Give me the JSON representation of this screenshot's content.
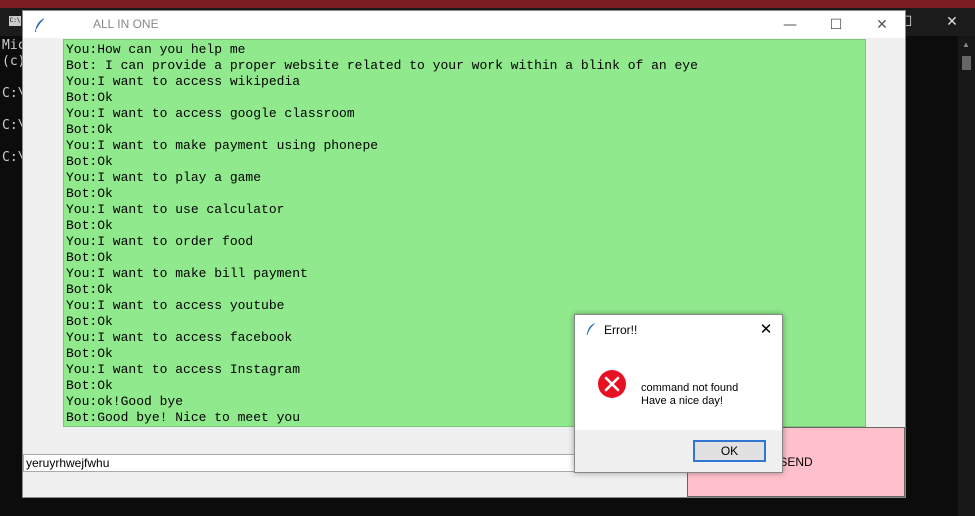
{
  "console": {
    "icon_text": "C:\\",
    "lines": [
      "Mic",
      "(c)",
      "",
      "C:\\",
      "",
      "C:\\",
      "",
      "C:\\"
    ],
    "controls": [
      "—",
      "☐",
      "✕"
    ]
  },
  "main_window": {
    "title": "ALL IN ONE",
    "controls": [
      "—",
      "☐",
      "✕"
    ],
    "chat_lines": [
      "You:How can you help me",
      "Bot: I can provide a proper website related to your work within a blink of an eye",
      "You:I want to access wikipedia",
      "Bot:Ok",
      "You:I want to access google classroom",
      "Bot:Ok",
      "You:I want to make payment using phonepe",
      "Bot:Ok",
      "You:I want to play a game",
      "Bot:Ok",
      "You:I want to use calculator",
      "Bot:Ok",
      "You:I want to order food",
      "Bot:Ok",
      "You:I want to make bill payment",
      "Bot:Ok",
      "You:I want to access youtube",
      "Bot:Ok",
      "You:I want to access facebook",
      "Bot:Ok",
      "You:I want to access Instagram",
      "Bot:Ok",
      "You:ok!Good bye",
      "Bot:Good bye! Nice to meet you"
    ],
    "input_value": "yeruyrhwejfwhu",
    "send_label": "SEND"
  },
  "error_dialog": {
    "title": "Error!!",
    "close_glyph": "✕",
    "message_line1": "command not found",
    "message_line2": "Have a nice day!",
    "ok_label": "OK"
  },
  "colors": {
    "chat_bg": "#90ea8d",
    "send_bg": "#ffc0cb",
    "error_icon": "#e81123"
  }
}
